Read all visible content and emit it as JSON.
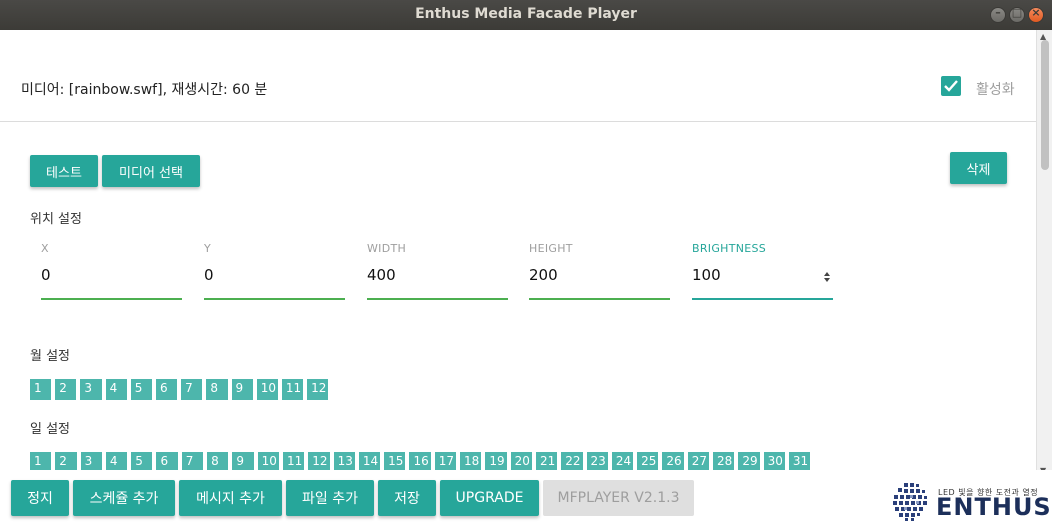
{
  "window": {
    "title": "Enthus Media Facade Player"
  },
  "header": {
    "media_info": "미디어: [rainbow.swf], 재생시간: 60 분",
    "active_label": "활성화",
    "active_checked": true
  },
  "actions": {
    "test_label": "테스트",
    "select_media_label": "미디어 선택",
    "delete_label": "삭제"
  },
  "position": {
    "section_label": "위치 설정",
    "fields": [
      {
        "label": "X",
        "value": "0"
      },
      {
        "label": "Y",
        "value": "0"
      },
      {
        "label": "WIDTH",
        "value": "400"
      },
      {
        "label": "HEIGHT",
        "value": "200"
      },
      {
        "label": "BRIGHTNESS",
        "value": "100"
      }
    ]
  },
  "months": {
    "section_label": "월 설정",
    "items": [
      "1",
      "2",
      "3",
      "4",
      "5",
      "6",
      "7",
      "8",
      "9",
      "10",
      "11",
      "12"
    ]
  },
  "days": {
    "section_label": "일 설정",
    "items": [
      "1",
      "2",
      "3",
      "4",
      "5",
      "6",
      "7",
      "8",
      "9",
      "10",
      "11",
      "12",
      "13",
      "14",
      "15",
      "16",
      "17",
      "18",
      "19",
      "20",
      "21",
      "22",
      "23",
      "24",
      "25",
      "26",
      "27",
      "28",
      "29",
      "30",
      "31"
    ]
  },
  "footer": {
    "stop_label": "정지",
    "add_schedule_label": "스케쥴 추가",
    "add_message_label": "메시지 추가",
    "add_file_label": "파일 추가",
    "save_label": "저장",
    "upgrade_label": "UPGRADE",
    "version_label": "MFPLAYER V2.1.3"
  },
  "logo": {
    "tagline": "LED 빛을 향한 도전과 열정",
    "brand": "ENTHUS"
  },
  "colors": {
    "accent": "#26a69a",
    "chip": "#4db6ac",
    "underline": "#4caf50"
  }
}
